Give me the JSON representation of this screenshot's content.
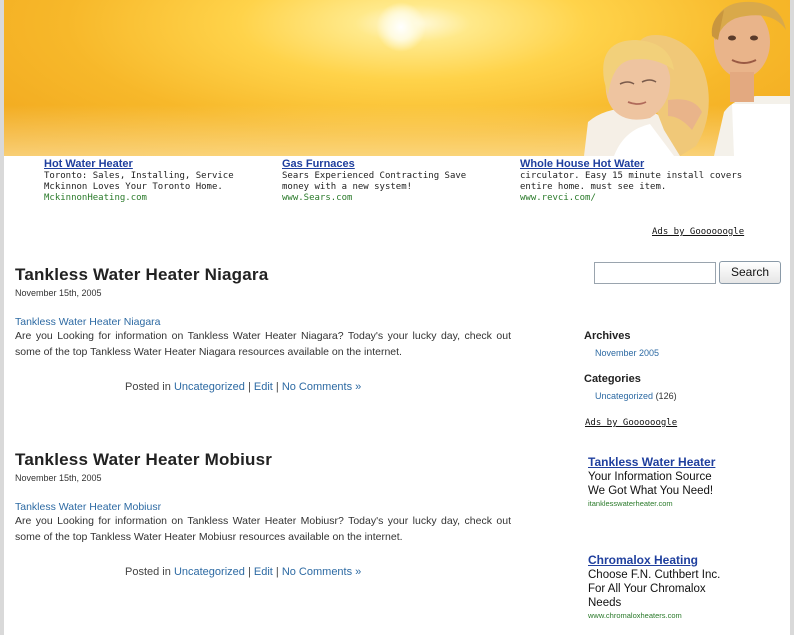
{
  "header": {
    "image": "banner-sun-couple"
  },
  "top_ads": [
    {
      "title": "Hot Water Heater",
      "text": "Toronto: Sales, Installing, Service\nMckinnon Loves Your Toronto Home.",
      "url": "MckinnonHeating.com"
    },
    {
      "title": "Gas Furnaces",
      "text": "Sears Experienced Contracting Save\nmoney with a new system!",
      "url": "www.Sears.com"
    },
    {
      "title": "Whole House Hot Water",
      "text": "circulator. Easy 15 minute install covers\nentire home. must see item.",
      "url": "www.revci.com/"
    }
  ],
  "ads_by_label": "Ads by Goooooogle",
  "posts": [
    {
      "title": "Tankless Water Heater Niagara",
      "date": "November 15th, 2005",
      "link": "Tankless Water Heater Niagara",
      "body": "Are you Looking for information on Tankless Water Heater Niagara? Today's your lucky day, check out some of the top Tankless Water Heater Niagara resources available on the internet.",
      "posted_in": "Posted in",
      "category": "Uncategorized",
      "sep": "|",
      "edit": "Edit",
      "comments": "No Comments »"
    },
    {
      "title": "Tankless Water Heater Mobiusr",
      "date": "November 15th, 2005",
      "link": "Tankless Water Heater Mobiusr",
      "body": "Are you Looking for information on Tankless Water Heater Mobiusr? Today's your lucky day, check out some of the top Tankless Water Heater Mobiusr resources available on the internet.",
      "posted_in": "Posted in",
      "category": "Uncategorized",
      "sep": "|",
      "edit": "Edit",
      "comments": "No Comments »"
    }
  ],
  "sidebar": {
    "search_value": "",
    "search_button": "Search",
    "archives_heading": "Archives",
    "archives_item": "November 2005",
    "categories_heading": "Categories",
    "categories_item": "Uncategorized",
    "categories_count": "(126)",
    "ads_by_label": "Ads by Goooooogle",
    "ads": [
      {
        "title": "Tankless Water Heater",
        "line1": "Your Information Source",
        "line2": "We Got What You Need!",
        "line3": "",
        "url": "itanklesswaterheater.com"
      },
      {
        "title": "Chromalox Heating",
        "line1": "Choose F.N. Cuthbert Inc.",
        "line2": "For All Your Chromalox",
        "line3": "Needs",
        "url": "www.chromaloxheaters.com"
      }
    ]
  },
  "colors": {
    "link": "#2d6aa3",
    "ad_title": "#1f3f9e",
    "ad_url": "#2a7a2a",
    "banner": "#f7b82a"
  }
}
